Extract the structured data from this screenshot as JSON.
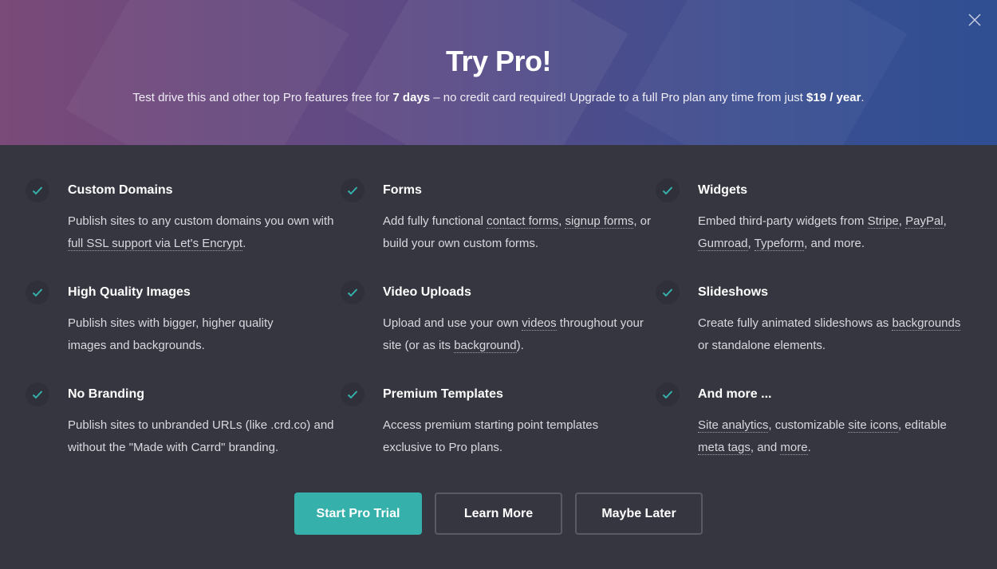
{
  "header": {
    "title": "Try Pro!",
    "subtitle_pre": "Test drive this and other top Pro features free for ",
    "subtitle_days": "7 days",
    "subtitle_mid": " – no credit card required! Upgrade to a full Pro plan any time from just ",
    "subtitle_price": "$19 / year",
    "subtitle_end": "."
  },
  "colors": {
    "accent": "#35b0ab",
    "background": "#363640",
    "header_gradient_start": "#7a4a78",
    "header_gradient_end": "#2f4f92"
  },
  "icons": {
    "close": "close-icon",
    "check": "check-icon"
  },
  "features": {
    "custom_domains": {
      "title": "Custom Domains",
      "t1": "Publish sites to any custom domains you own with ",
      "l1": "full SSL support via Let's Encrypt",
      "t2": "."
    },
    "forms": {
      "title": "Forms",
      "t1": "Add fully functional ",
      "l1": "contact forms",
      "t2": ", ",
      "l2": "signup forms",
      "t3": ", or build your own custom forms."
    },
    "widgets": {
      "title": "Widgets",
      "t1": "Embed third-party widgets from ",
      "l1": "Stripe",
      "t2": ", ",
      "l2": "PayPal",
      "t3": ", ",
      "l3": "Gumroad",
      "t4": ", ",
      "l4": "Typeform",
      "t5": ", and more."
    },
    "hq_images": {
      "title": "High Quality Images",
      "t1": "Publish sites with bigger, higher quality images and backgrounds."
    },
    "video_uploads": {
      "title": "Video Uploads",
      "t1": "Upload and use your own ",
      "l1": "videos",
      "t2": " throughout your site (or as its ",
      "l2": "background",
      "t3": ")."
    },
    "slideshows": {
      "title": "Slideshows",
      "t1": "Create fully animated slideshows as ",
      "l1": "backgrounds",
      "t2": " or standalone elements."
    },
    "no_branding": {
      "title": "No Branding",
      "t1": "Publish sites to unbranded URLs (like .crd.co) and without the \"Made with Carrd\" branding."
    },
    "premium_templates": {
      "title": "Premium Templates",
      "t1": "Access premium starting point templates exclusive to Pro plans."
    },
    "and_more": {
      "title": "And more ...",
      "l1": "Site analytics",
      "t1": ", customizable ",
      "l2": "site icons",
      "t2": ", editable ",
      "l3": "meta tags",
      "t3": ", and ",
      "l4": "more",
      "t4": "."
    }
  },
  "buttons": {
    "start": "Start Pro Trial",
    "learn": "Learn More",
    "later": "Maybe Later"
  }
}
